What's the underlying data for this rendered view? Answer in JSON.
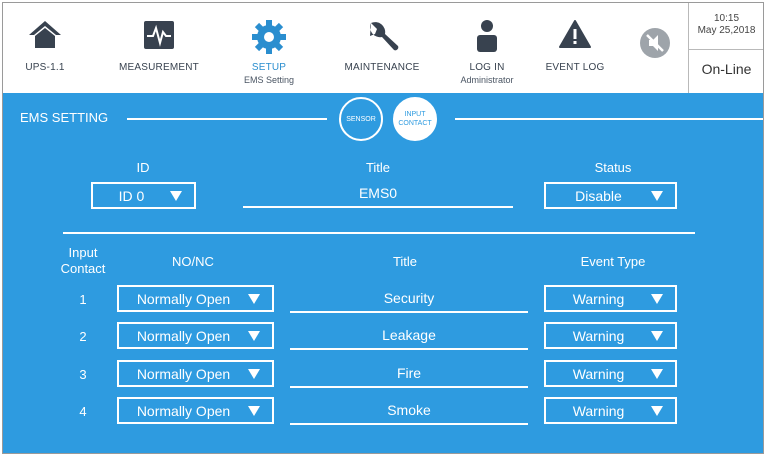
{
  "topbar": {
    "items": [
      {
        "label": "UPS-1.1",
        "sub": "",
        "icon": "home-icon"
      },
      {
        "label": "MEASUREMENT",
        "sub": "",
        "icon": "measurement-icon"
      },
      {
        "label": "SETUP",
        "sub": "EMS Setting",
        "icon": "gear-icon"
      },
      {
        "label": "MAINTENANCE",
        "sub": "",
        "icon": "wrench-icon"
      },
      {
        "label": "LOG IN",
        "sub": "Administrator",
        "icon": "user-icon"
      },
      {
        "label": "EVENT LOG",
        "sub": "",
        "icon": "warning-icon"
      }
    ],
    "mute_icon": "mute-icon",
    "time": "10:15",
    "date": "May 25,2018",
    "status": "On-Line"
  },
  "panel": {
    "title": "EMS SETTING",
    "tabs": {
      "sensor": "SENSOR",
      "input_contact_1": "INPUT",
      "input_contact_2": "CONTACT"
    },
    "id_label": "ID",
    "id_value": "ID 0",
    "title_label": "Title",
    "title_value": "EMS0",
    "status_label": "Status",
    "status_value": "Disable",
    "table": {
      "col_input_1": "Input",
      "col_input_2": "Contact",
      "col_nonc": "NO/NC",
      "col_title": "Title",
      "col_event": "Event Type",
      "rows": [
        {
          "num": "1",
          "nonc": "Normally Open",
          "title": "Security",
          "event": "Warning"
        },
        {
          "num": "2",
          "nonc": "Normally Open",
          "title": "Leakage",
          "event": "Warning"
        },
        {
          "num": "3",
          "nonc": "Normally Open",
          "title": "Fire",
          "event": "Warning"
        },
        {
          "num": "4",
          "nonc": "Normally Open",
          "title": "Smoke",
          "event": "Warning"
        }
      ]
    }
  },
  "colors": {
    "panel_bg": "#2e9be0",
    "accent": "#2a8ecf",
    "icon": "#38424f"
  }
}
